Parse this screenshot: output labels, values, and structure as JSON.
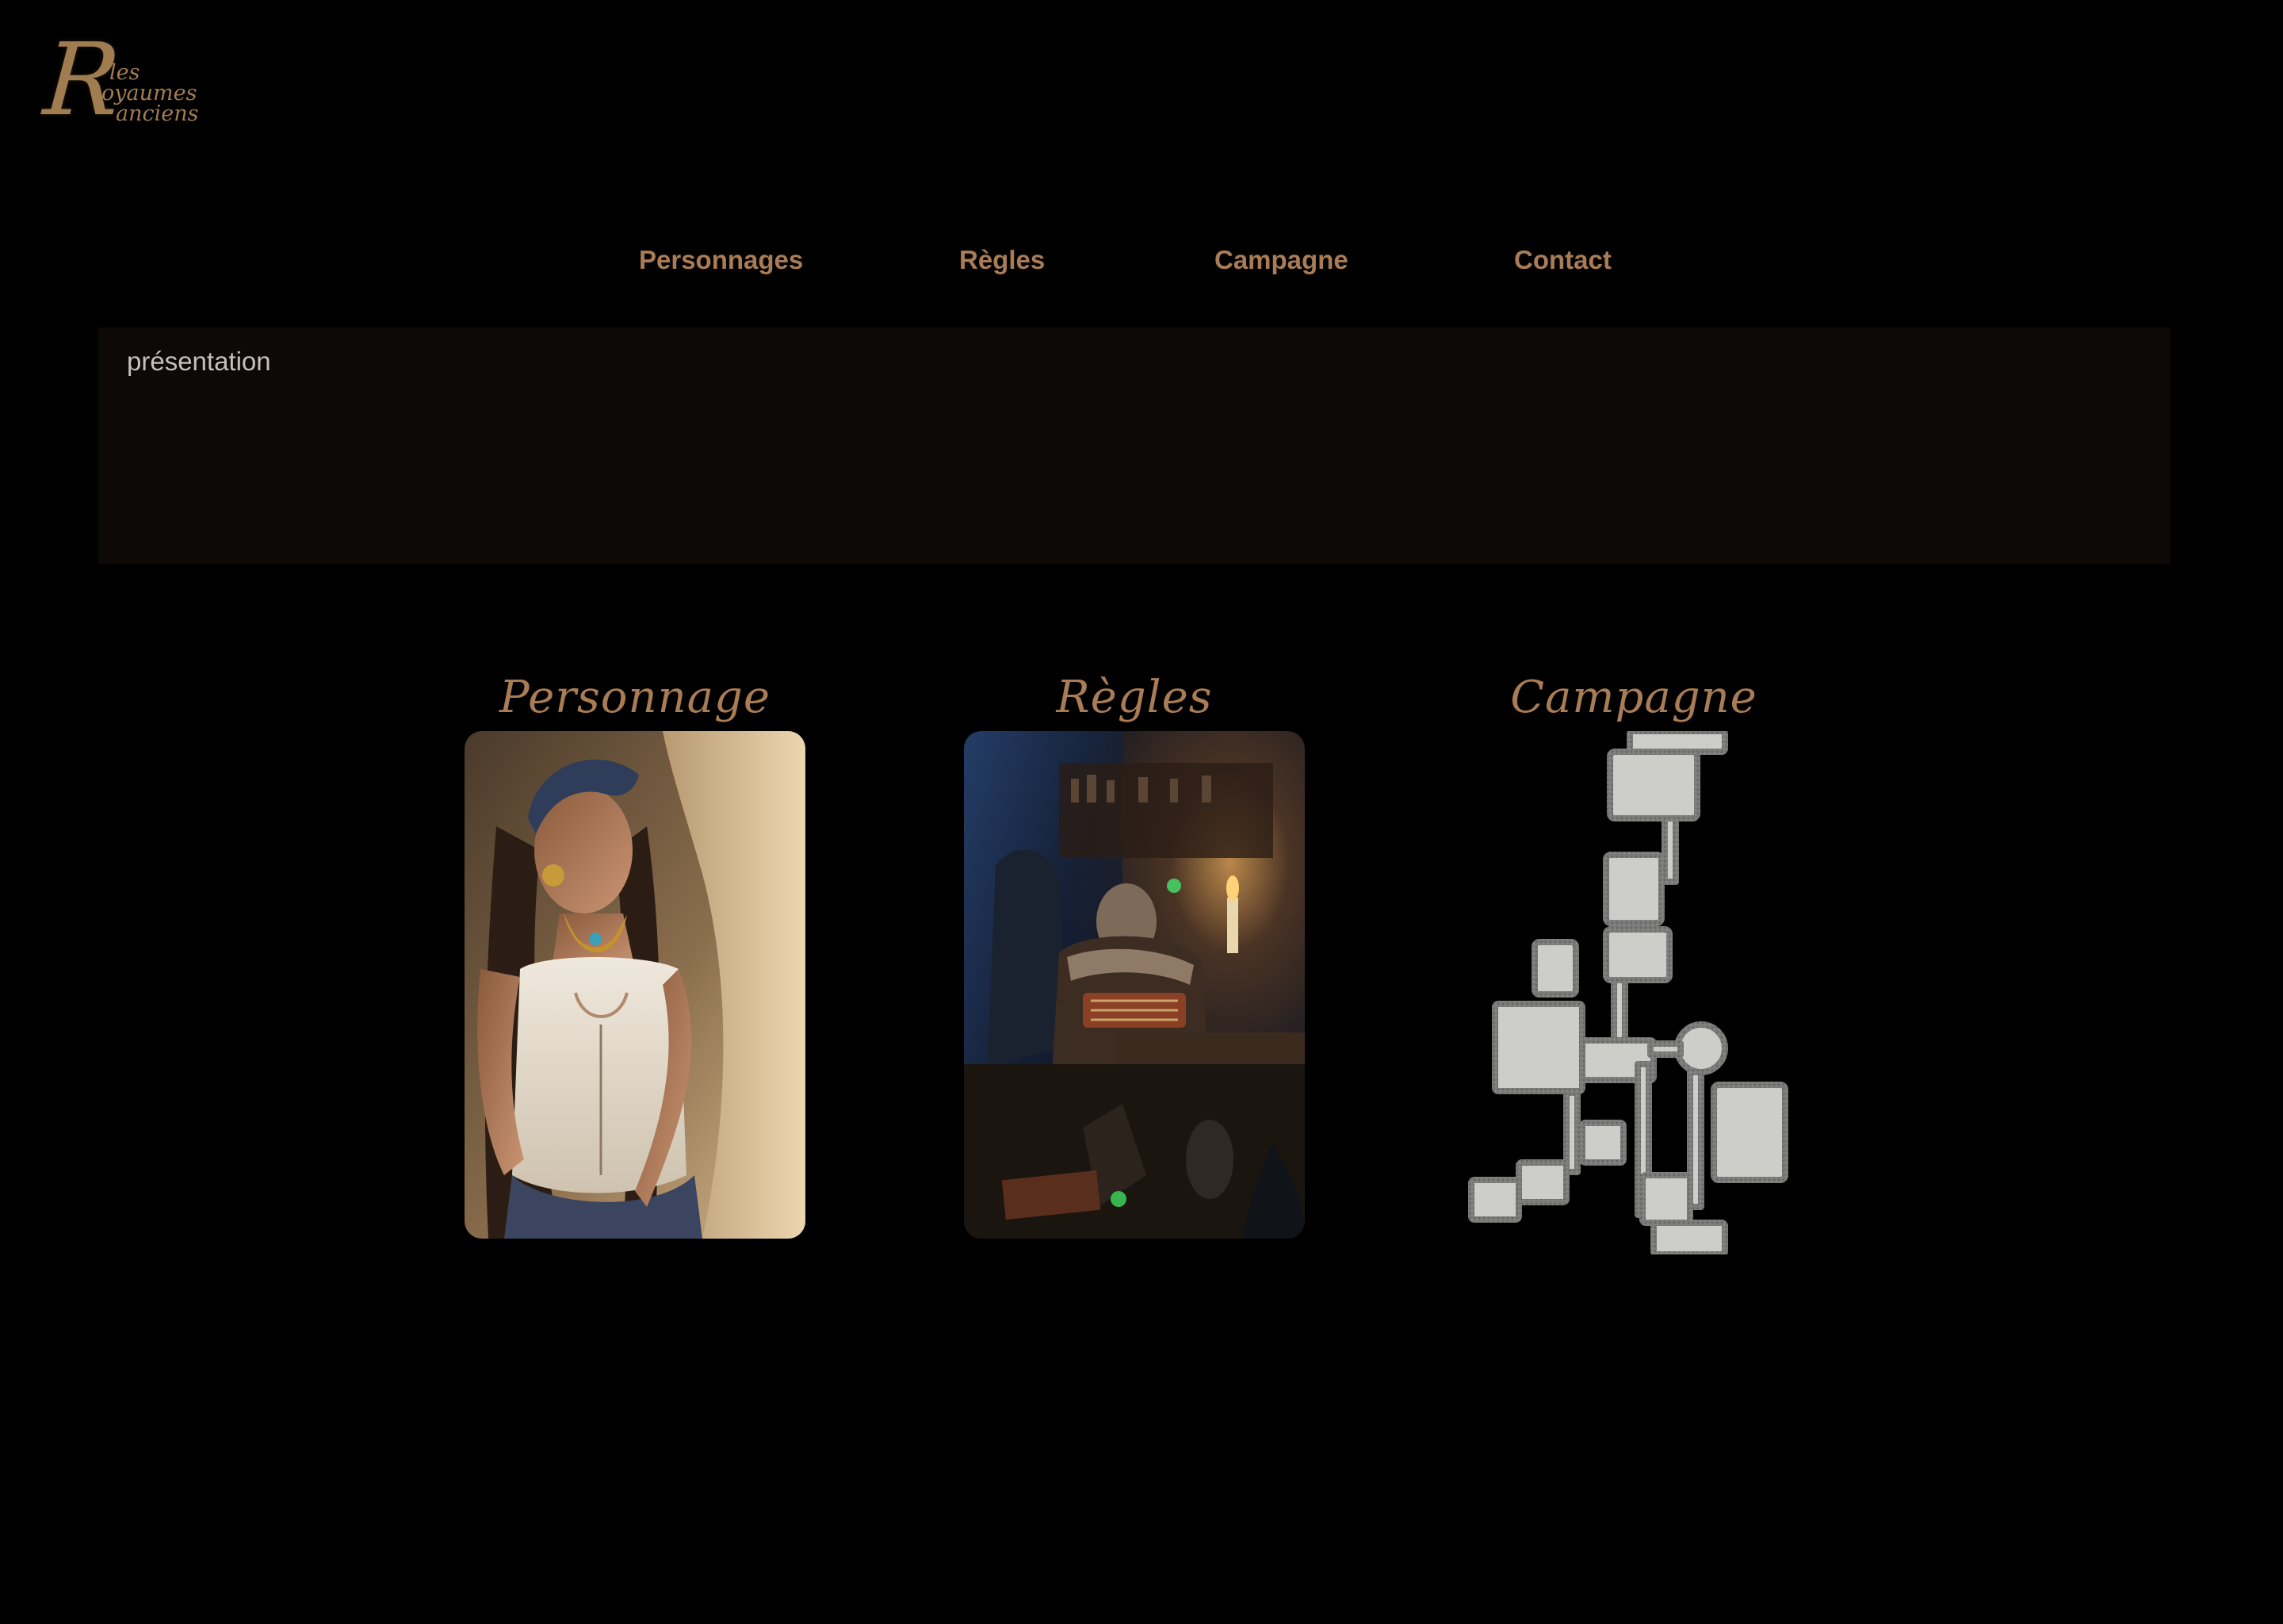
{
  "logo": {
    "letter": "R",
    "line1": "les",
    "line2": "oyaumes",
    "line3": "anciens"
  },
  "nav": {
    "items": [
      {
        "label": "Personnages"
      },
      {
        "label": "Règles"
      },
      {
        "label": "Campagne"
      },
      {
        "label": "Contact"
      }
    ]
  },
  "presentation": {
    "text": "présentation"
  },
  "cards": [
    {
      "title": "Personnage",
      "image": "character-portrait"
    },
    {
      "title": "Règles",
      "image": "tavern-dwarf-scene"
    },
    {
      "title": "Campagne",
      "image": "dungeon-map"
    }
  ],
  "colors": {
    "background": "#000000",
    "accent": "#a97c55",
    "panel": "#0c0907",
    "text_muted": "#c6c1bb"
  }
}
